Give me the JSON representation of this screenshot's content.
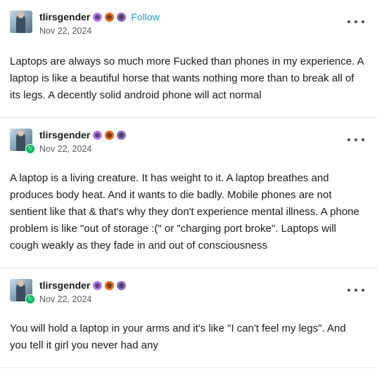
{
  "posts": [
    {
      "username": "tlirsgender",
      "follow_label": "Follow",
      "date": "Nov 22, 2024",
      "reblogged": false,
      "text": "Laptops are always so much more Fucked than phones in my experience. A laptop is like a beautiful horse that wants nothing more than to break all of its legs. A decently solid android phone will act normal"
    },
    {
      "username": "tlirsgender",
      "date": "Nov 22, 2024",
      "reblogged": true,
      "text": "A laptop is a living creature. It has weight to it. A laptop breathes and produces body heat. And it wants to die badly. Mobile phones are not sentient like that & that's why they don't experience mental illness. A phone problem is like \"out of storage :(\" or \"charging port broke\". Laptops will cough weakly as they fade in and out of consciousness"
    },
    {
      "username": "tlirsgender",
      "date": "Nov 22, 2024",
      "reblogged": true,
      "text": "You will hold a laptop in your arms and it's like \"I can't feel my legs\". And you tell it girl you never had any"
    }
  ],
  "icons": {
    "more": "more-options-icon",
    "reblog": "reblog-icon",
    "badges": [
      "purple-badge-icon",
      "orange-paw-badge-icon",
      "violet-badge-icon"
    ]
  },
  "colors": {
    "follow": "#1a9fe0",
    "reblog_badge": "#00b85c",
    "divider": "#e4e4e4"
  }
}
